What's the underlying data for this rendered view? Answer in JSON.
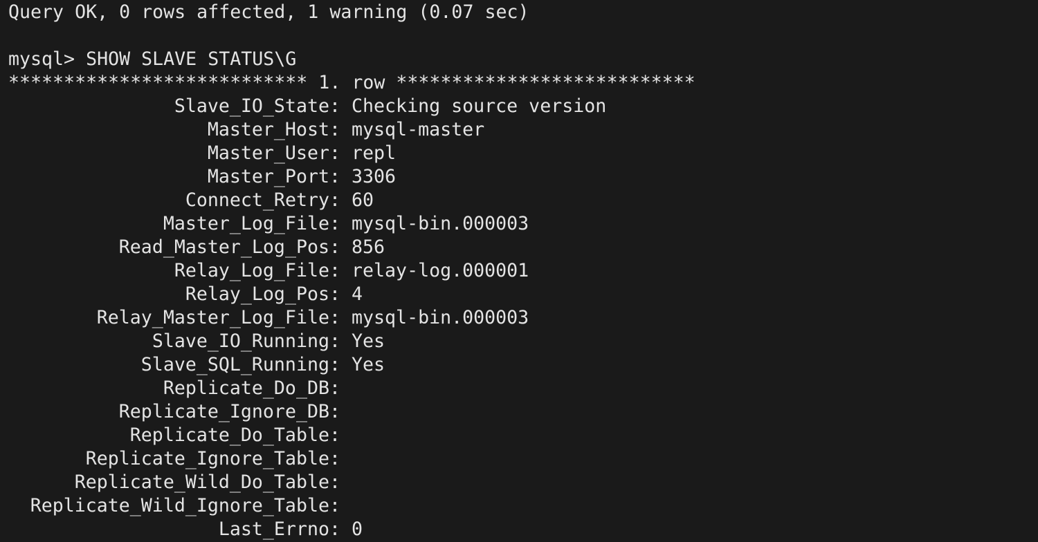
{
  "terminal": {
    "query_result": "Query OK, 0 rows affected, 1 warning (0.07 sec)",
    "blank": "",
    "prompt_command": "mysql> SHOW SLAVE STATUS\\G",
    "row_header": "*************************** 1. row ***************************",
    "status_rows": [
      {
        "field": "Slave_IO_State:",
        "value": "Checking source version"
      },
      {
        "field": "Master_Host:",
        "value": "mysql-master"
      },
      {
        "field": "Master_User:",
        "value": "repl"
      },
      {
        "field": "Master_Port:",
        "value": "3306"
      },
      {
        "field": "Connect_Retry:",
        "value": "60"
      },
      {
        "field": "Master_Log_File:",
        "value": "mysql-bin.000003"
      },
      {
        "field": "Read_Master_Log_Pos:",
        "value": "856"
      },
      {
        "field": "Relay_Log_File:",
        "value": "relay-log.000001"
      },
      {
        "field": "Relay_Log_Pos:",
        "value": "4"
      },
      {
        "field": "Relay_Master_Log_File:",
        "value": "mysql-bin.000003"
      },
      {
        "field": "Slave_IO_Running:",
        "value": "Yes"
      },
      {
        "field": "Slave_SQL_Running:",
        "value": "Yes"
      },
      {
        "field": "Replicate_Do_DB:",
        "value": ""
      },
      {
        "field": "Replicate_Ignore_DB:",
        "value": ""
      },
      {
        "field": "Replicate_Do_Table:",
        "value": ""
      },
      {
        "field": "Replicate_Ignore_Table:",
        "value": ""
      },
      {
        "field": "Replicate_Wild_Do_Table:",
        "value": ""
      },
      {
        "field": "Replicate_Wild_Ignore_Table:",
        "value": ""
      },
      {
        "field": "Last_Errno:",
        "value": "0"
      }
    ]
  },
  "colors": {
    "background": "#1a1a1a",
    "text": "#e4e4e4"
  }
}
